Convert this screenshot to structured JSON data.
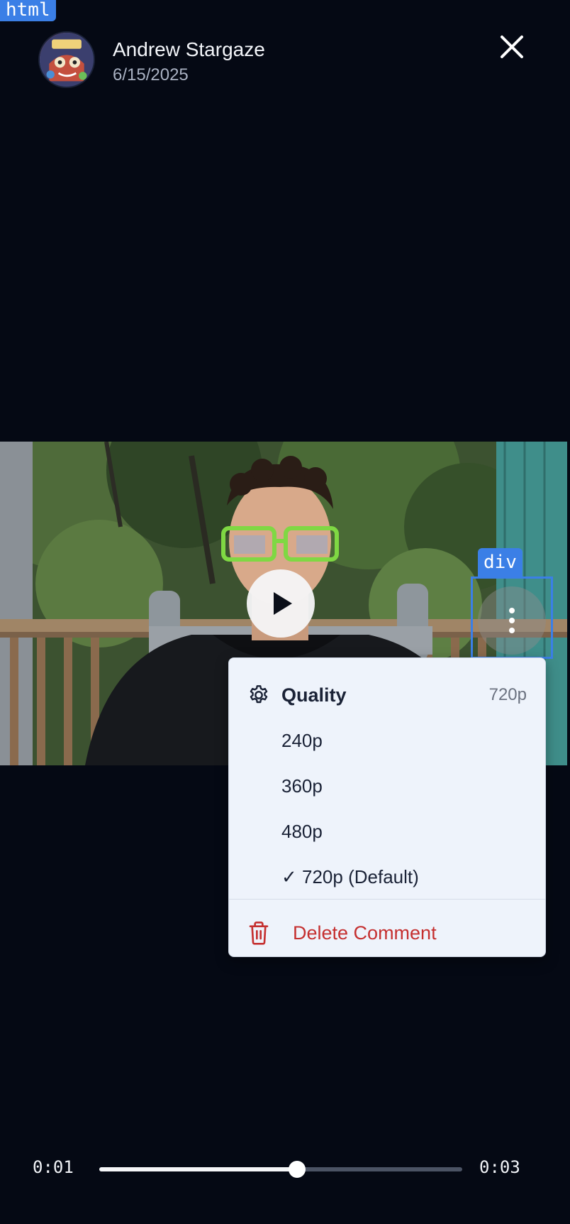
{
  "devtools": {
    "html_tag": "html",
    "div_tag": "div"
  },
  "header": {
    "author_name": "Andrew Stargaze",
    "date": "6/15/2025",
    "avatar_icon": "avatar-image",
    "close_icon": "close-icon"
  },
  "player": {
    "play_icon": "play-icon",
    "more_icon": "more-vertical-icon",
    "current_time": "0:01",
    "total_time": "0:03",
    "progress_fraction": 0.545
  },
  "menu": {
    "quality_label": "Quality",
    "quality_current": "720p",
    "options": [
      {
        "label": "240p"
      },
      {
        "label": "360p"
      },
      {
        "label": "480p"
      },
      {
        "label": "✓ 720p (Default)"
      }
    ],
    "delete_label": "Delete Comment"
  },
  "colors": {
    "background": "#050914",
    "menu_background": "#eef3fb",
    "delete_red": "#c53030",
    "devtools_blue": "#3b7fe6"
  }
}
